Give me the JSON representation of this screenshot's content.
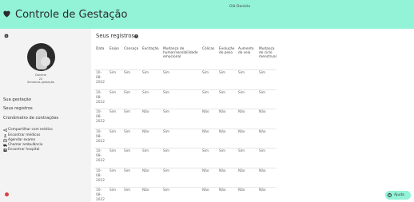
{
  "header": {
    "title": "Controle de Gestação",
    "user_greeting": "Olá Daniela",
    "brand_color": "#92f3d6"
  },
  "sidebar": {
    "user_name": "Daniela",
    "user_weeks": "22",
    "user_subtitle": "Semanas gestação",
    "nav": [
      "Sua gestação",
      "Seus registros",
      "Cronômetro de contrações"
    ],
    "links": [
      {
        "label": "Compartilhar com médico",
        "icon": "share-icon"
      },
      {
        "label": "Encontrar médicos",
        "icon": "doctor-icon"
      },
      {
        "label": "Agendar exame",
        "icon": "calendar-icon"
      },
      {
        "label": "Chamar ambulância",
        "icon": "ambulance-icon"
      },
      {
        "label": "Encontrar hospital",
        "icon": "hospital-icon"
      }
    ]
  },
  "main": {
    "title": "Seus registros",
    "columns": [
      "Data",
      "Enjoo",
      "Cansaço",
      "Excitação",
      "Mudança de humor/sensibilidade emocional",
      "Cólicas",
      "Evolução do peso",
      "Aumento do seio",
      "Mudança do ciclo menstrual"
    ],
    "rows": [
      {
        "date": [
          "10-",
          "08-",
          "2022"
        ],
        "values": [
          "Sim",
          "Sim",
          "Sim",
          "Sim",
          "Sim",
          "Sim",
          "Sim",
          "Sim"
        ]
      },
      {
        "date": [
          "10-",
          "08-",
          "2022"
        ],
        "values": [
          "Sim",
          "Sim",
          "Sim",
          "Sim",
          "Sim",
          "Sim",
          "Sim",
          "Sim"
        ]
      },
      {
        "date": [
          "10-",
          "08-",
          "2022"
        ],
        "values": [
          "Sim",
          "Sim",
          "Não",
          "Sim",
          "Não",
          "Não",
          "Não",
          "Não"
        ]
      },
      {
        "date": [
          "10-",
          "08-",
          "2022"
        ],
        "values": [
          "Sim",
          "Sim",
          "Não",
          "Sim",
          "Não",
          "Não",
          "Não",
          "Não"
        ]
      },
      {
        "date": [
          "10-",
          "08-",
          "2022"
        ],
        "values": [
          "Sim",
          "Sim",
          "Sim",
          "Sim",
          "Sim",
          "Sim",
          "Sim",
          "Sim"
        ]
      },
      {
        "date": [
          "10-",
          "08-",
          "2022"
        ],
        "values": [
          "Sim",
          "Sim",
          "Não",
          "Sim",
          "Não",
          "Não",
          "Não",
          "Não"
        ]
      },
      {
        "date": [
          "10-",
          "08-",
          "2022"
        ],
        "values": [
          "Sim",
          "Sim",
          "Não",
          "Sim",
          "Não",
          "Não",
          "Não",
          "Não"
        ]
      }
    ]
  },
  "help_button": {
    "label": "Ajuda"
  }
}
